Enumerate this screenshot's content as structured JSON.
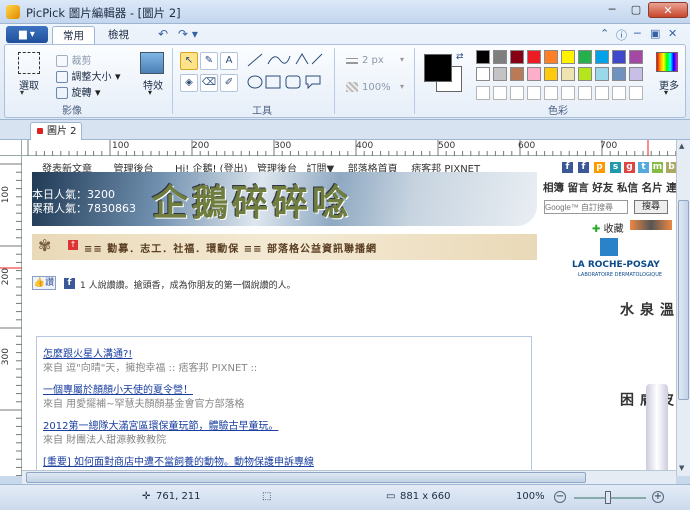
{
  "window": {
    "title": "PicPick 圖片編輯器 - [圖片 2]"
  },
  "ribbon": {
    "tabs": [
      "常用",
      "檢視"
    ],
    "groups": {
      "image": "影像",
      "tools": "工具",
      "colors": "色彩"
    },
    "select_label": "選取",
    "crop_label": "裁剪",
    "resize_label": "調整大小",
    "rotate_label": "旋轉",
    "effects_label": "特效",
    "line_width": "2 px",
    "opacity": "100%",
    "more_colors_label": "更多",
    "palette": [
      "#000000",
      "#7f7f7f",
      "#880015",
      "#ed1c24",
      "#ff7f27",
      "#fff200",
      "#22b14c",
      "#00a2e8",
      "#3f48cc",
      "#a349a4",
      "#ffffff",
      "#c3c3c3",
      "#b97a57",
      "#ffaec9",
      "#ffc90e",
      "#efe4b0",
      "#b5e61d",
      "#99d9ea",
      "#7092be",
      "#c8bfe7"
    ]
  },
  "doc_tab": {
    "label": "圖片 2"
  },
  "ruler": {
    "h_labels": [
      "100",
      "200",
      "300",
      "400",
      "500",
      "600",
      "700"
    ],
    "v_labels": [
      "100",
      "200",
      "300"
    ]
  },
  "webpage": {
    "nav": [
      "發表新文章",
      "管理後台",
      "Hi! 企鵝! (登出)",
      "管理後台",
      "訂閱▼",
      "部落格首頁",
      "痞客邦 PIXNET"
    ],
    "visitors_today": "本日人氣：3200",
    "visitors_total": "累積人氣：7830863",
    "banner_text": "企鵝碎碎唸",
    "slogan": "≡≡ 勸募．志工．社福．環動保 ≡≡ 部落格公益資訊聯播網",
    "like_label": "讚",
    "like_text": "1 人說讚讚。搶頭香，成為你朋友的第一個說讚的人。",
    "posts": [
      {
        "title": "怎麼跟火星人溝通?!",
        "source": "來自 逗\"向晴\"天，擁抱幸福 :: 痞客邦 PIXNET ::"
      },
      {
        "title": "一個專屬於顏顏小天使的夏令營！",
        "source": "來自 用愛擺補~罕慧夫顏顏基金會官方部落格"
      },
      {
        "title": "2012第一總隊大滿宮區環保童玩節，體驗古早童玩。",
        "source": "來自 財團法人甜源教教教院"
      },
      {
        "title": "[重要] 如何面對商店中遭不當飼養的動物。動物保護申訴專線",
        "source": ""
      }
    ],
    "sidebar": {
      "links": "相簿 留言 好友 私信 名片 連",
      "search_placeholder": "Google™ 自訂搜尋",
      "search_button": "搜尋",
      "collect_label": "收藏",
      "ad_brand": "LA ROCHE-POSAY",
      "ad_sub": "LABORATOIRE DERMATOLOGIQUE",
      "ad_text1": "神奇溫泉水",
      "ad_text2": "改善皮膚困"
    }
  },
  "status": {
    "cursor": "761, 211",
    "size": "881 x 660",
    "zoom": "100%"
  }
}
